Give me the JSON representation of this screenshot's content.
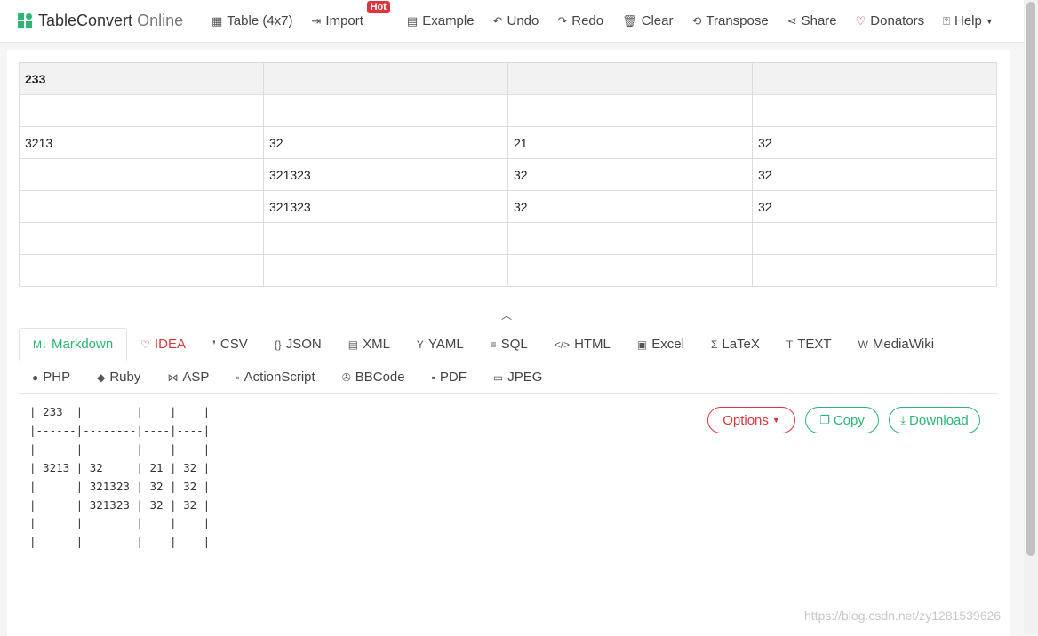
{
  "brand": {
    "name": "TableConvert",
    "suffix": "Online"
  },
  "nav": {
    "table": {
      "label": "Table (4x7)",
      "icon": "grid-icon"
    },
    "import": {
      "label": "Import",
      "badge": "Hot",
      "icon": "import-icon"
    },
    "example": {
      "label": "Example",
      "icon": "example-icon"
    },
    "undo": {
      "label": "Undo",
      "icon": "undo-icon"
    },
    "redo": {
      "label": "Redo",
      "icon": "redo-icon"
    },
    "clear": {
      "label": "Clear",
      "icon": "trash-icon"
    },
    "transpose": {
      "label": "Transpose",
      "icon": "transpose-icon"
    },
    "share": {
      "label": "Share",
      "icon": "share-icon"
    },
    "donators": {
      "label": "Donators",
      "icon": "heart-icon"
    },
    "help": {
      "label": "Help",
      "icon": "help-icon"
    }
  },
  "grid": {
    "rows": [
      [
        "233",
        "",
        "",
        ""
      ],
      [
        "",
        "",
        "",
        ""
      ],
      [
        "3213",
        "32",
        "21",
        "32"
      ],
      [
        "",
        "321323",
        "32",
        "32"
      ],
      [
        "",
        "321323",
        "32",
        "32"
      ],
      [
        "",
        "",
        "",
        ""
      ],
      [
        "",
        "",
        "",
        ""
      ]
    ]
  },
  "tabs": {
    "row1": [
      {
        "label": "Markdown",
        "icon": "M↓"
      },
      {
        "label": "IDEA",
        "icon": "♡"
      },
      {
        "label": "CSV",
        "icon": "❜"
      },
      {
        "label": "JSON",
        "icon": "{}"
      },
      {
        "label": "XML",
        "icon": "▤"
      },
      {
        "label": "YAML",
        "icon": "Y"
      },
      {
        "label": "SQL",
        "icon": "≡"
      },
      {
        "label": "HTML",
        "icon": "</>"
      },
      {
        "label": "Excel",
        "icon": "▣"
      },
      {
        "label": "LaTeX",
        "icon": "Σ"
      },
      {
        "label": "TEXT",
        "icon": "T"
      },
      {
        "label": "MediaWiki",
        "icon": "W"
      }
    ],
    "row2": [
      {
        "label": "PHP",
        "icon": "●"
      },
      {
        "label": "Ruby",
        "icon": "◆"
      },
      {
        "label": "ASP",
        "icon": "⋈"
      },
      {
        "label": "ActionScript",
        "icon": "▫"
      },
      {
        "label": "BBCode",
        "icon": "✇"
      },
      {
        "label": "PDF",
        "icon": "▪"
      },
      {
        "label": "JPEG",
        "icon": "▭"
      }
    ]
  },
  "output": {
    "text": "| 233  |        |    |    |\n|------|--------|----|----|\n|      |        |    |    |\n| 3213 | 32     | 21 | 32 |\n|      | 321323 | 32 | 32 |\n|      | 321323 | 32 | 32 |\n|      |        |    |    |\n|      |        |    |    |"
  },
  "actions": {
    "options": "Options",
    "copy": "Copy",
    "download": "Download"
  },
  "watermark": "https://blog.csdn.net/zy1281539626",
  "colors": {
    "accent": "#2bb673",
    "danger": "#d9363e"
  }
}
